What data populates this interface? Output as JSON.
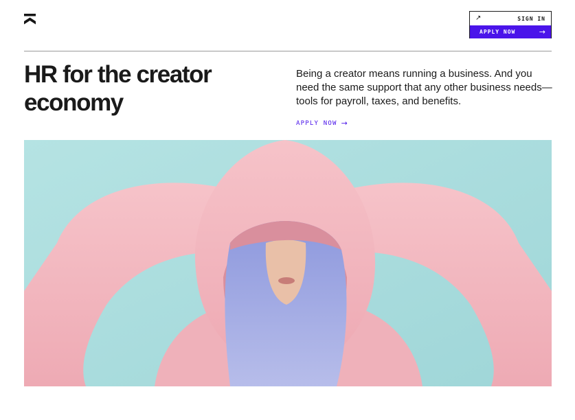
{
  "header": {
    "logo_icon": "chevron-stack-logo",
    "sign_in_icon": "arrow-up-right-icon",
    "sign_in_label": "SIGN IN",
    "apply_label": "APPLY NOW",
    "apply_icon": "arrow-right-icon"
  },
  "hero": {
    "headline": "HR for the creator economy",
    "lede": "Being a creator means running a business. And you need the same support that any other business needs—tools for payroll, taxes, and benefits.",
    "cta_label": "APPLY NOW",
    "cta_icon": "arrow-right-icon",
    "image_subject": "person-in-pink-hoodie-with-blue-hair"
  },
  "colors": {
    "accent": "#4a14ea",
    "background": "#ffffff",
    "text": "#1a1a1a",
    "hero_backdrop": "#a9dede",
    "hoodie": "#f2b8c0",
    "hair": "#9fa7e2"
  }
}
